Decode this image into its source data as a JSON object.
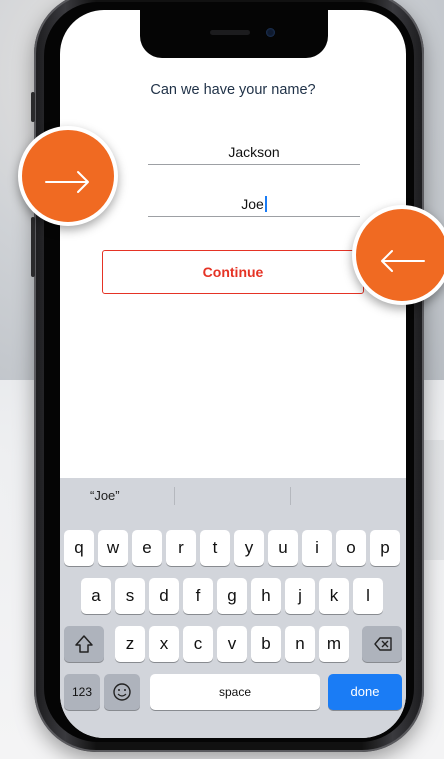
{
  "screen": {
    "title": "Can we have your name?",
    "last_name_value": "Jackson",
    "first_name_value": "Joe",
    "continue_label": "Continue"
  },
  "keyboard": {
    "suggestion": "“Joe”",
    "row1": [
      "q",
      "w",
      "e",
      "r",
      "t",
      "y",
      "u",
      "i",
      "o",
      "p"
    ],
    "row2": [
      "a",
      "s",
      "d",
      "f",
      "g",
      "h",
      "j",
      "k",
      "l"
    ],
    "row3": [
      "z",
      "x",
      "c",
      "v",
      "b",
      "n",
      "m"
    ],
    "numbers_label": "123",
    "space_label": "space",
    "done_label": "done",
    "shift_icon": "shift-icon",
    "delete_icon": "backspace-icon",
    "emoji_icon": "emoji-icon"
  },
  "annotations": {
    "left_arrow_icon": "arrow-right-icon",
    "right_arrow_icon": "arrow-left-icon",
    "accent_color": "#f06a22"
  }
}
